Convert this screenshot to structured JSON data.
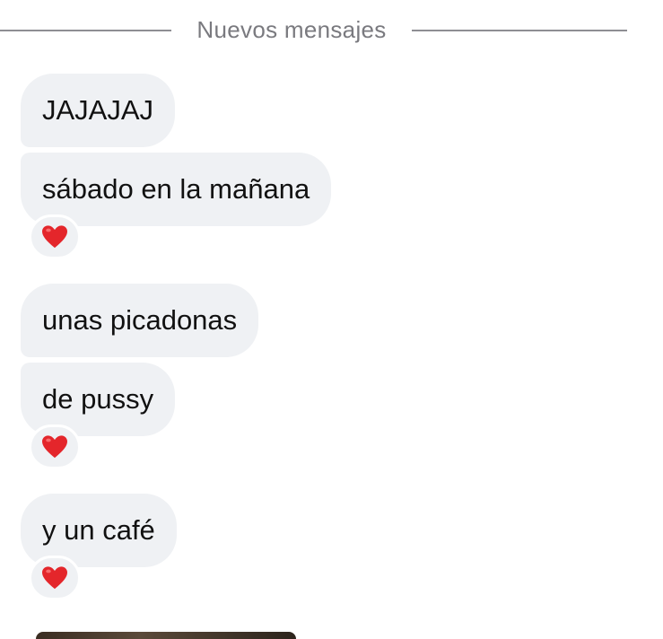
{
  "divider": {
    "label": "Nuevos mensajes"
  },
  "messages": [
    {
      "text": "JAJAJAJ",
      "reaction": null
    },
    {
      "text": "sábado en la mañana",
      "reaction": "heart"
    },
    {
      "text": "unas picadonas",
      "reaction": null
    },
    {
      "text": "de pussy",
      "reaction": "heart"
    },
    {
      "text": "y un café",
      "reaction": "heart"
    }
  ],
  "colors": {
    "bubble_background": "#eff1f4",
    "divider_line": "#8e8e93",
    "divider_text": "#7a7a7f",
    "heart": "#e4262b"
  },
  "icons": {
    "reaction": "red-heart-icon"
  }
}
